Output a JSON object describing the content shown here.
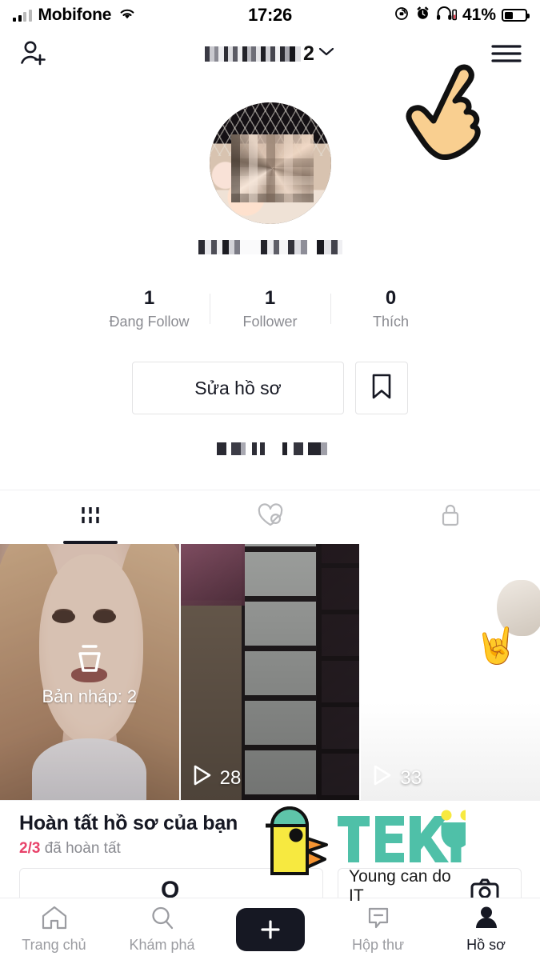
{
  "statusbar": {
    "carrier": "Mobifone",
    "time": "17:26",
    "battery_percent": "41%",
    "icons": [
      "signal-bars-icon",
      "wifi-icon",
      "rotation-lock-icon",
      "alarm-clock-icon",
      "headphones-icon",
      "battery-icon"
    ]
  },
  "header": {
    "add_person_icon": "add-person-icon",
    "username_suffix": "2",
    "chevron": "⌄",
    "menu_icon": "hamburger-menu-icon",
    "hand_cursor": "pointing-hand-cursor"
  },
  "profile": {
    "avatar_alt": "profile-avatar",
    "stats": [
      {
        "value": "1",
        "label": "Đang Follow"
      },
      {
        "value": "1",
        "label": "Follower"
      },
      {
        "value": "0",
        "label": "Thích"
      }
    ],
    "edit_button": "Sửa hồ sơ",
    "bookmark_icon": "bookmark-icon"
  },
  "tabs": [
    {
      "icon": "grid-posts-icon",
      "active": true
    },
    {
      "icon": "heart-crossed-liked-icon",
      "active": false
    },
    {
      "icon": "lock-private-icon",
      "active": false
    }
  ],
  "videos": [
    {
      "overlay_label": "Bản nháp: 2",
      "icon": "drafts-icon",
      "views": ""
    },
    {
      "overlay_label": "",
      "icon": "play-icon",
      "views": "28"
    },
    {
      "overlay_label": "",
      "icon": "play-icon",
      "views": "33"
    }
  ],
  "banner": {
    "title": "Hoàn tất hồ sơ của bạn",
    "progress": "2/3",
    "progress_suffix": " đã hoàn tất",
    "card_glyph": "O",
    "camera_icon": "camera-icon"
  },
  "logo": {
    "name": "TEKY",
    "tagline": "Young can do IT",
    "color": "#4fc0a8",
    "bird_body": "#f7e940",
    "bird_head": "#5ec5a9",
    "bird_beak": "#f59432"
  },
  "bottomnav": [
    {
      "label": "Trang chủ",
      "icon": "home-icon",
      "active": false
    },
    {
      "label": "Khám phá",
      "icon": "search-icon",
      "active": false
    },
    {
      "label": "",
      "icon": "create-plus-icon",
      "active": false
    },
    {
      "label": "Hộp thư",
      "icon": "inbox-icon",
      "active": false
    },
    {
      "label": "Hồ sơ",
      "icon": "profile-person-icon",
      "active": true
    }
  ],
  "colors": {
    "accent_pink": "#fe2c55",
    "accent_cyan": "#25f4ee",
    "text_dark": "#161823",
    "text_muted": "#8a8b91",
    "progress_pink": "#e8436a"
  }
}
